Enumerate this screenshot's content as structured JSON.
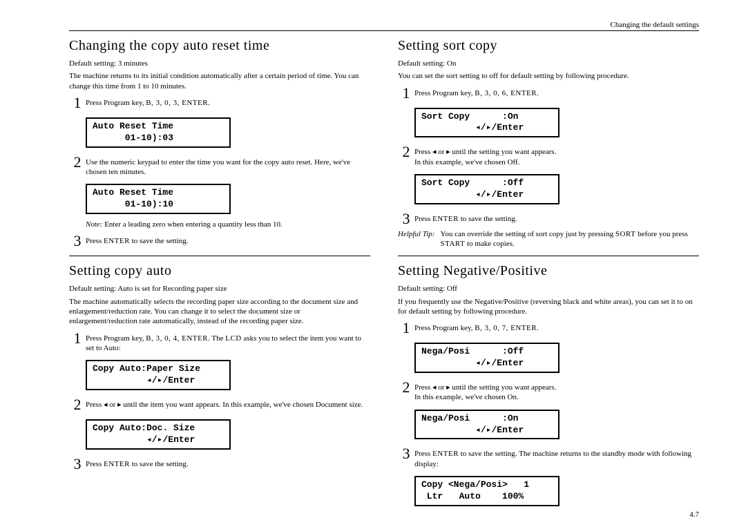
{
  "header": "Changing the default settings",
  "pagenum": "4.7",
  "left": {
    "s1": {
      "title": "Changing the copy auto reset time",
      "default": "Default setting: 3 minutes",
      "intro": "The machine returns to its initial condition automatically after a certain period of time. You can change this time from 1 to 10 minutes.",
      "step1_a": "Press Program key, ",
      "step1_b": "B, 3, 0, 3, ",
      "step1_c": "ENTER",
      "step1_d": ".",
      "lcd1": "Auto Reset Time\n      01-10):03",
      "step2": "Use the numeric keypad to enter the time you want for the copy auto reset. Here, we've chosen ten minutes.",
      "lcd2": "Auto Reset Time\n      01-10):10",
      "note_label": "Note:",
      "note": "Enter a leading zero when entering a quantity less than 10.",
      "step3_a": "Press ",
      "step3_b": "ENTER",
      "step3_c": " to save the setting."
    },
    "s2": {
      "title": "Setting copy auto",
      "default": "Default setting: Auto is set for Recording paper size",
      "intro": "The machine automatically selects the recording paper size according to the document size and enlargement/reduction rate. You can change it to select the document size or enlargement/reduction rate automatically, instead of the recording paper size.",
      "step1_a": "Press Program key, ",
      "step1_b": "B, 3, 0, 4, ",
      "step1_c": "ENTER",
      "step1_d": ". The ",
      "step1_e": "LCD",
      "step1_f": " asks you to select the item you want to set to Auto:",
      "lcd1": "Copy Auto:Paper Size\n          ◂/▸/Enter",
      "step2_a": "Press ◂ or ▸ until the item you want appears. In this example, we've chosen ",
      "step2_b": "Document size",
      "step2_c": ".",
      "lcd2": "Copy Auto:Doc. Size\n          ◂/▸/Enter",
      "step3_a": "Press ",
      "step3_b": "ENTER",
      "step3_c": " to save the setting."
    }
  },
  "right": {
    "s1": {
      "title": "Setting sort copy",
      "default": "Default setting: On",
      "intro": "You can set the sort setting to off for default setting by following procedure.",
      "step1_a": "Press Program key, ",
      "step1_b": "B, 3, 0, 6, ",
      "step1_c": "ENTER",
      "step1_d": ".",
      "lcd1": "Sort Copy      :On\n          ◂/▸/Enter",
      "step2_a": "Press ◂ or ▸ until the setting you want appears.",
      "step2_b": "In this example, we've chosen Off.",
      "lcd2": "Sort Copy      :Off\n          ◂/▸/Enter",
      "step3_a": "Press ",
      "step3_b": "ENTER",
      "step3_c": " to save the setting.",
      "tip_label": "Helpful Tip:",
      "tip_a": "You can override the setting of sort copy just by pressing ",
      "tip_b": "SORT",
      "tip_c": " before you press ",
      "tip_d": "START",
      "tip_e": " to make copies."
    },
    "s2": {
      "title": "Setting Negative/Positive",
      "default": "Default setting: Off",
      "intro": "If you frequently use the Negative/Positive (reversing black and white areas), you can set it to on for default setting by following procedure.",
      "step1_a": "Press Program key, ",
      "step1_b": "B, 3, 0, 7, ",
      "step1_c": "ENTER",
      "step1_d": ".",
      "lcd1": "Nega/Posi      :Off\n          ◂/▸/Enter",
      "step2_a": "Press ◂ or ▸ until the setting you want appears.",
      "step2_b": "In this example, we've chosen On.",
      "lcd2": "Nega/Posi      :On\n          ◂/▸/Enter",
      "step3_a": "Press ",
      "step3_b": "ENTER",
      "step3_c": " to save the setting. The machine returns to the standby mode with following display:",
      "lcd3": "Copy <Nega/Posi>   1\n Ltr   Auto    100%"
    }
  }
}
